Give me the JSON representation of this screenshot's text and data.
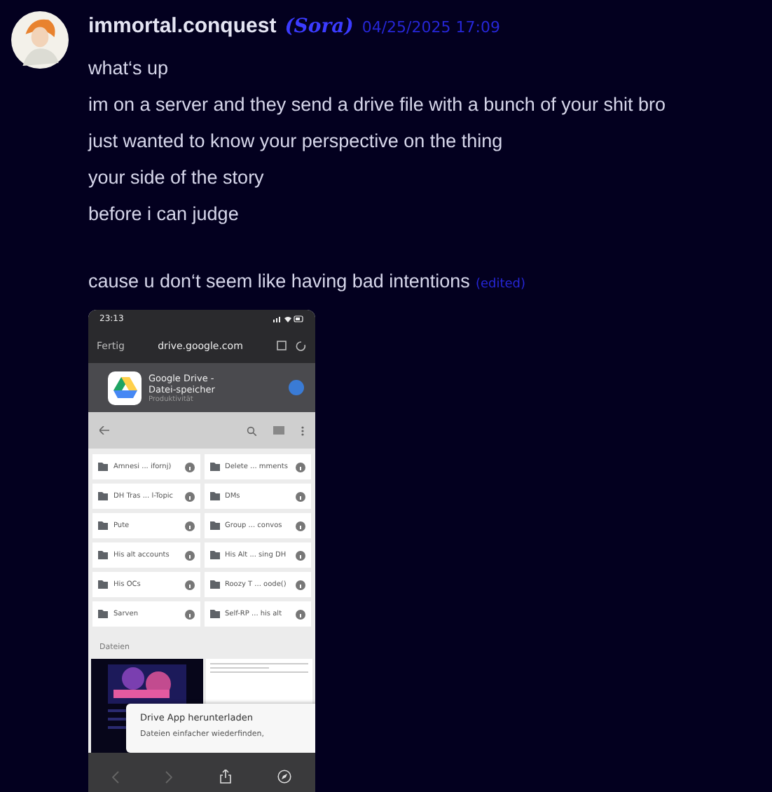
{
  "message": {
    "author": "immortal.conquest",
    "nickname": "(Sora)",
    "timestamp": "04/25/2025 17:09",
    "paragraphs": [
      [
        "what‘s up",
        "im on a server and they send a drive file with a bunch of your shit bro",
        "just wanted to know your perspective on the thing",
        "your side of the story",
        "before i can judge"
      ],
      [
        "cause u don‘t seem like having bad intentions"
      ]
    ],
    "edited_label": "(edited)"
  },
  "attachment": {
    "status_time": "23:13",
    "done_label": "Fertig",
    "url": "drive.google.com",
    "app_banner": {
      "title": "Google Drive - Datei-speicher",
      "category": "Produktivität"
    },
    "folders": [
      {
        "name": "Amnesi ... ifornj)"
      },
      {
        "name": "Delete ... mments"
      },
      {
        "name": "DH Tras ... l-Topic"
      },
      {
        "name": "DMs"
      },
      {
        "name": "Pute"
      },
      {
        "name": "Group ... convos"
      },
      {
        "name": "His alt accounts"
      },
      {
        "name": "His Alt ... sing DH"
      },
      {
        "name": "His OCs"
      },
      {
        "name": "Roozy T ... oode()"
      },
      {
        "name": "Sarven"
      },
      {
        "name": "Self-RP ... his alt"
      }
    ],
    "files_heading": "Dateien",
    "popup": {
      "title": "Drive App herunterladen",
      "text": "Dateien einfacher wiederfinden,"
    }
  }
}
